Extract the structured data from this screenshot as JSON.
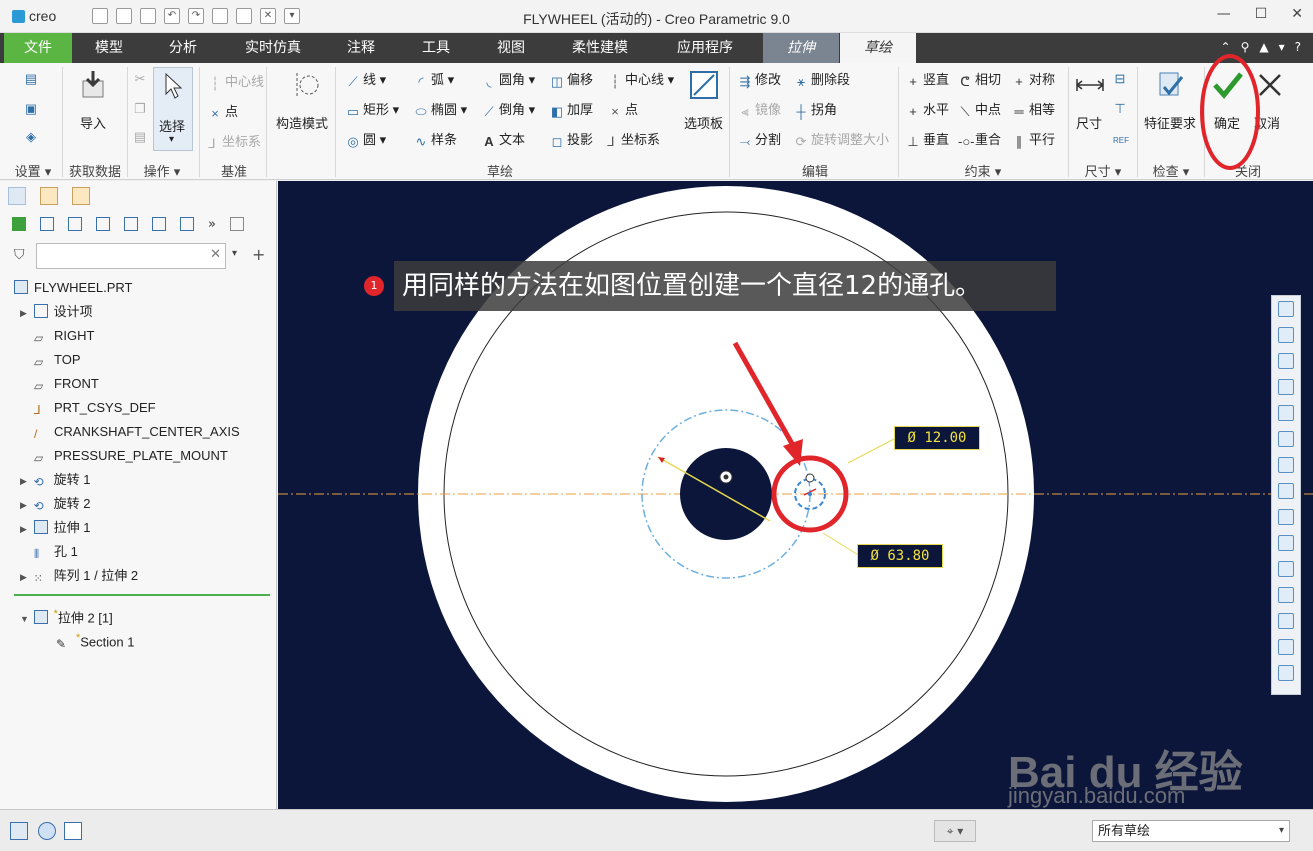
{
  "app": {
    "logo": "creo",
    "title": "FLYWHEEL (活动的) - Creo Parametric 9.0"
  },
  "tabs": {
    "file": "文件",
    "model": "模型",
    "analysis": "分析",
    "simulation": "实时仿真",
    "annotate": "注释",
    "tools": "工具",
    "view": "视图",
    "flexible": "柔性建模",
    "apps": "应用程序",
    "extrude": "拉伸",
    "sketch": "草绘"
  },
  "ribbon": {
    "setup": "设置",
    "import": "导入",
    "get_data": "获取数据",
    "select": "选择",
    "operations": "操作",
    "datum_centerline": "中心线",
    "datum_point": "点",
    "datum_csys": "坐标系",
    "datum": "基准",
    "construction_mode": "构造模式",
    "line": "线",
    "arc": "弧",
    "fillet": "圆角",
    "offset": "偏移",
    "centerline": "中心线",
    "rectangle": "矩形",
    "ellipse": "椭圆",
    "chamfer": "倒角",
    "thicken": "加厚",
    "point": "点",
    "circle": "圆",
    "spline": "样条",
    "text": "文本",
    "project": "投影",
    "csys": "坐标系",
    "palette": "选项板",
    "sketching": "草绘",
    "modify": "修改",
    "delete_segment": "删除段",
    "mirror": "镜像",
    "corner": "拐角",
    "divide": "分割",
    "rotate_resize": "旋转调整大小",
    "editing": "编辑",
    "vertical": "竖直",
    "tangent": "相切",
    "symmetric": "对称",
    "horizontal": "水平",
    "midpoint": "中点",
    "equal": "相等",
    "perpendicular": "垂直",
    "coincident": "重合",
    "parallel": "平行",
    "constrain": "约束",
    "dimension": "尺寸",
    "dimension_group": "尺寸",
    "feature_requirements": "特征要求",
    "inspect": "检查",
    "ok": "确定",
    "cancel": "取消",
    "close": "关闭"
  },
  "tree": {
    "root": "FLYWHEEL.PRT",
    "items": [
      "设计项",
      "RIGHT",
      "TOP",
      "FRONT",
      "PRT_CSYS_DEF",
      "CRANKSHAFT_CENTER_AXIS",
      "PRESSURE_PLATE_MOUNT",
      "旋转 1",
      "旋转 2",
      "拉伸 1",
      "孔 1",
      "阵列 1 / 拉伸 2"
    ],
    "active_feature": "拉伸 2 [1]",
    "section": "Section 1",
    "new_marker": "*"
  },
  "viewport": {
    "instruction_number": "1",
    "instruction": "用同样的方法在如图位置创建一个直径12的通孔。",
    "dim_small": "Ø 12.00",
    "dim_large": "Ø 63.80",
    "watermark_main": "Bai du 经验",
    "watermark_url": "jingyan.baidu.com"
  },
  "statusbar": {
    "filter": "所有草绘"
  },
  "colors": {
    "viewport_bg": "#0c163a",
    "file_tab": "#5bb543",
    "annotation_red": "#e0252b",
    "dim_yellow": "#f0e040",
    "construction_blue": "#6cb0e0"
  }
}
